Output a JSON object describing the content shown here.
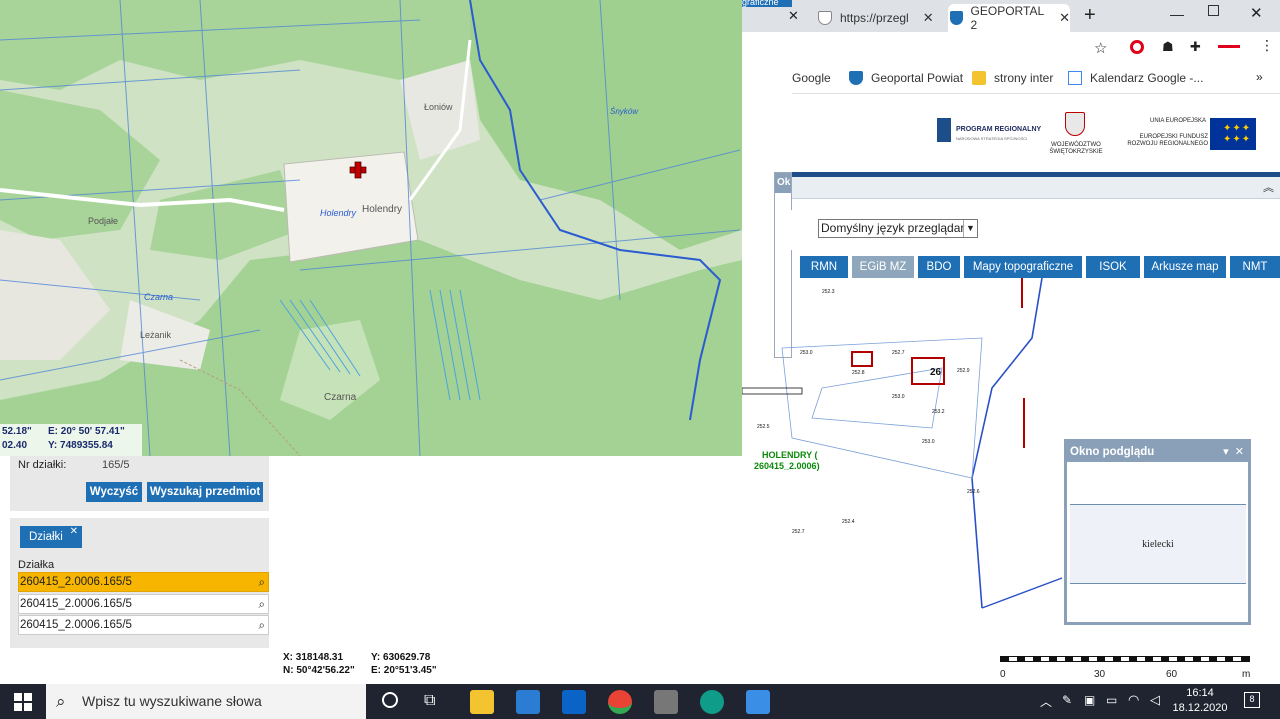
{
  "browser": {
    "tabs": [
      {
        "label": "https://przegl",
        "icon": "shield-icon"
      },
      {
        "label": "GEOPORTAL 2",
        "icon": "shield-icon"
      }
    ],
    "partial_tab_title": "graficzne",
    "bookmarks": [
      {
        "label": "Google"
      },
      {
        "label": "Geoportal Powiat",
        "icon": "shield-icon"
      },
      {
        "label": "strony inter",
        "icon": "folder-icon"
      },
      {
        "label": "Kalendarz Google -...",
        "icon": "calendar-icon"
      }
    ]
  },
  "banner": {
    "program": "PROGRAM REGIONALNY",
    "program_sub": "NARODOWA STRATEGIA SPÓJNOŚCI",
    "wojewodztwo": "WOJEWÓDZTWO ŚWIĘTOKRZYSKIE",
    "ue_title": "UNIA EUROPEJSKA",
    "ue_sub": "EUROPEJSKI FUNDUSZ ROZWOJU REGIONALNEGO"
  },
  "geoportal": {
    "panel_stub": "Ok",
    "language_select": "Domyślny język przeglądar",
    "nav": [
      "RMN",
      "EGiB MZ",
      "BDO",
      "Mapy topograficzne",
      "ISOK",
      "Arkusze map",
      "NMT"
    ],
    "active_nav": "EGiB MZ",
    "parcel_label_1": "HOLENDRY (",
    "parcel_label_2": "260415_2.0006)",
    "scale_labels": [
      "0",
      "30",
      "60",
      "m"
    ]
  },
  "map": {
    "places": [
      "Holendry",
      "Holendry",
      "Łoniów",
      "Leżanik",
      "Czarna",
      "Czarna",
      "Podjałe",
      "Śnyków"
    ],
    "coords": {
      "lat": "52.18\"",
      "e_label": "E: 20° 50' 57.41\"",
      "x_val": "02.40",
      "y_label": "Y: 7489355.84"
    }
  },
  "search": {
    "nr_label": "Nr działki:",
    "nr_value": "165/5",
    "clear_label": "Wyczyść",
    "search_label": "Wyszukaj przedmiot"
  },
  "results": {
    "tab_label": "Działki",
    "column": "Działka",
    "rows": [
      "260415_2.0006.165/5",
      "260415_2.0006.165/5",
      "260415_2.0006.165/5"
    ]
  },
  "bottom_coords": {
    "x": "X: 318148.31",
    "y": "Y: 630629.78",
    "n": "N: 50°42'56.22\"",
    "e": "E: 20°51'3.45\""
  },
  "preview": {
    "title": "Okno podglądu",
    "content": "kielecki"
  },
  "taskbar": {
    "search_placeholder": "Wpisz tu wyszukiwane słowa",
    "time": "16:14",
    "date": "18.12.2020",
    "notif_count": "8"
  }
}
